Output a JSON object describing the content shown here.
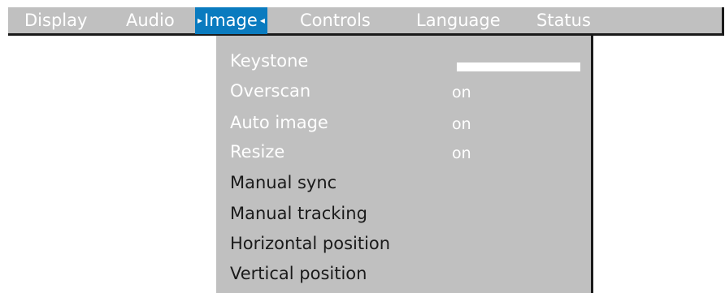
{
  "menubar": {
    "tabs": [
      {
        "label": "Display"
      },
      {
        "label": "Audio"
      },
      {
        "label": "Image",
        "active": true,
        "left_marker": "▸",
        "right_marker": "◂"
      },
      {
        "label": "Controls"
      },
      {
        "label": "Language"
      },
      {
        "label": "Status"
      }
    ]
  },
  "submenu": {
    "items": [
      {
        "label": "Keystone",
        "state": "disabled",
        "value_type": "slider"
      },
      {
        "label": "Overscan",
        "state": "disabled",
        "value": "on"
      },
      {
        "label": "Auto image",
        "state": "disabled",
        "value": "on"
      },
      {
        "label": "Resize",
        "state": "disabled",
        "value": "on"
      },
      {
        "label": "Manual sync",
        "state": "enabled"
      },
      {
        "label": "Manual tracking",
        "state": "enabled"
      },
      {
        "label": "Horizontal position",
        "state": "enabled"
      },
      {
        "label": "Vertical position",
        "state": "enabled"
      }
    ]
  },
  "colors": {
    "menu_bg": "#c0c0c0",
    "active_tab_bg": "#0a7bbf",
    "enabled_text": "#1a1a1a",
    "disabled_text": "#ffffff",
    "border": "#1a1a1a"
  }
}
